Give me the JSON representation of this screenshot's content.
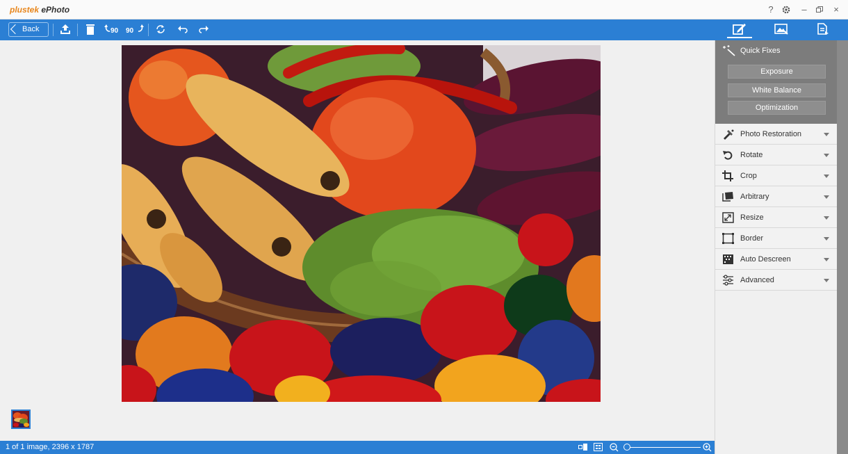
{
  "app": {
    "brand": "plustek",
    "product": "ePhoto"
  },
  "window_controls": {
    "help": "?",
    "settings": "gear-icon",
    "minimize": "–",
    "restore": "restore-icon",
    "close": "×"
  },
  "toolbar": {
    "back_label": "Back",
    "rotate_left_label": "90",
    "rotate_right_label": "90",
    "icons": [
      "upload-icon",
      "trash-icon",
      "rotate-left-90-icon",
      "rotate-right-90-icon",
      "flip-icon",
      "undo-icon",
      "redo-icon"
    ]
  },
  "right_tabs": [
    {
      "name": "edit",
      "icon": "edit-icon",
      "active": true
    },
    {
      "name": "enhance",
      "icon": "image-enhance-icon",
      "active": false
    },
    {
      "name": "export",
      "icon": "document-export-icon",
      "active": false
    }
  ],
  "quick_fixes": {
    "title": "Quick Fixes",
    "buttons": [
      "Exposure",
      "White Balance",
      "Optimization"
    ]
  },
  "panels": [
    {
      "label": "Photo Restoration",
      "icon": "restoration-icon"
    },
    {
      "label": "Rotate",
      "icon": "rotate-icon"
    },
    {
      "label": "Crop",
      "icon": "crop-icon"
    },
    {
      "label": "Arbitrary",
      "icon": "arbitrary-icon"
    },
    {
      "label": "Resize",
      "icon": "resize-icon"
    },
    {
      "label": "Border",
      "icon": "border-icon"
    },
    {
      "label": "Auto Descreen",
      "icon": "descreen-icon"
    },
    {
      "label": "Advanced",
      "icon": "sliders-icon"
    }
  ],
  "status": {
    "text": "1 of 1 image, 2396 x 1787"
  },
  "colors": {
    "accent": "#2b7fd4",
    "quick_fixes_bg": "#7c7c7c",
    "brand_orange": "#e8861c"
  }
}
